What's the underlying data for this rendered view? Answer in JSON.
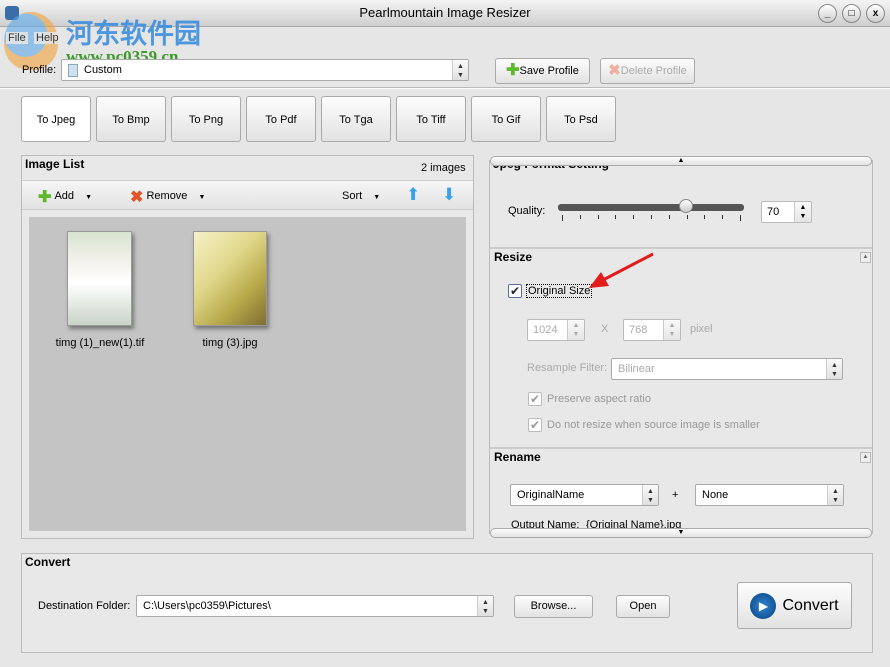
{
  "window": {
    "title": "Pearlmountain Image Resizer",
    "min": "_",
    "max": "□",
    "close": "x"
  },
  "menu": [
    "File",
    "Help"
  ],
  "watermark": {
    "name": "河东软件园",
    "url": "www.pc0359.cn"
  },
  "profile": {
    "label": "Profile:",
    "value": "Custom",
    "save": "Save Profile",
    "delete": "Delete Profile"
  },
  "tabs": [
    "To Jpeg",
    "To Bmp",
    "To Png",
    "To Pdf",
    "To Tga",
    "To Tiff",
    "To Gif",
    "To Psd"
  ],
  "image_list": {
    "title": "Image List",
    "count": "2 images",
    "add": "Add",
    "remove": "Remove",
    "sort": "Sort",
    "images": [
      {
        "name": "timg (1)_new(1).tif"
      },
      {
        "name": "timg (3).jpg"
      }
    ]
  },
  "jpeg": {
    "title": "Jpeg Format Setting",
    "quality_label": "Quality:",
    "quality": 70,
    "quality_text": "70"
  },
  "resize": {
    "title": "Resize",
    "original_size": "Original Size",
    "original_checked": true,
    "width": "1024",
    "x": "X",
    "height": "768",
    "unit": "pixel",
    "filter_label": "Resample Filter:",
    "filter": "Bilinear",
    "preserve": "Preserve aspect ratio",
    "no_enlarge": "Do not resize when source image is smaller"
  },
  "rename": {
    "title": "Rename",
    "name": "OriginalName",
    "plus": "+",
    "suffix": "None",
    "output_label": "Output Name:",
    "output": "{Original Name}.jpg"
  },
  "convert": {
    "title": "Convert",
    "dest_label": "Destination Folder:",
    "dest": "C:\\Users\\pc0359\\Pictures\\",
    "browse": "Browse...",
    "open": "Open",
    "convert": "Convert"
  },
  "colors": {
    "accent": "#1c6fc4",
    "remove": "#e0542a",
    "add": "#5db82e",
    "arrow": "#e21b1b"
  }
}
